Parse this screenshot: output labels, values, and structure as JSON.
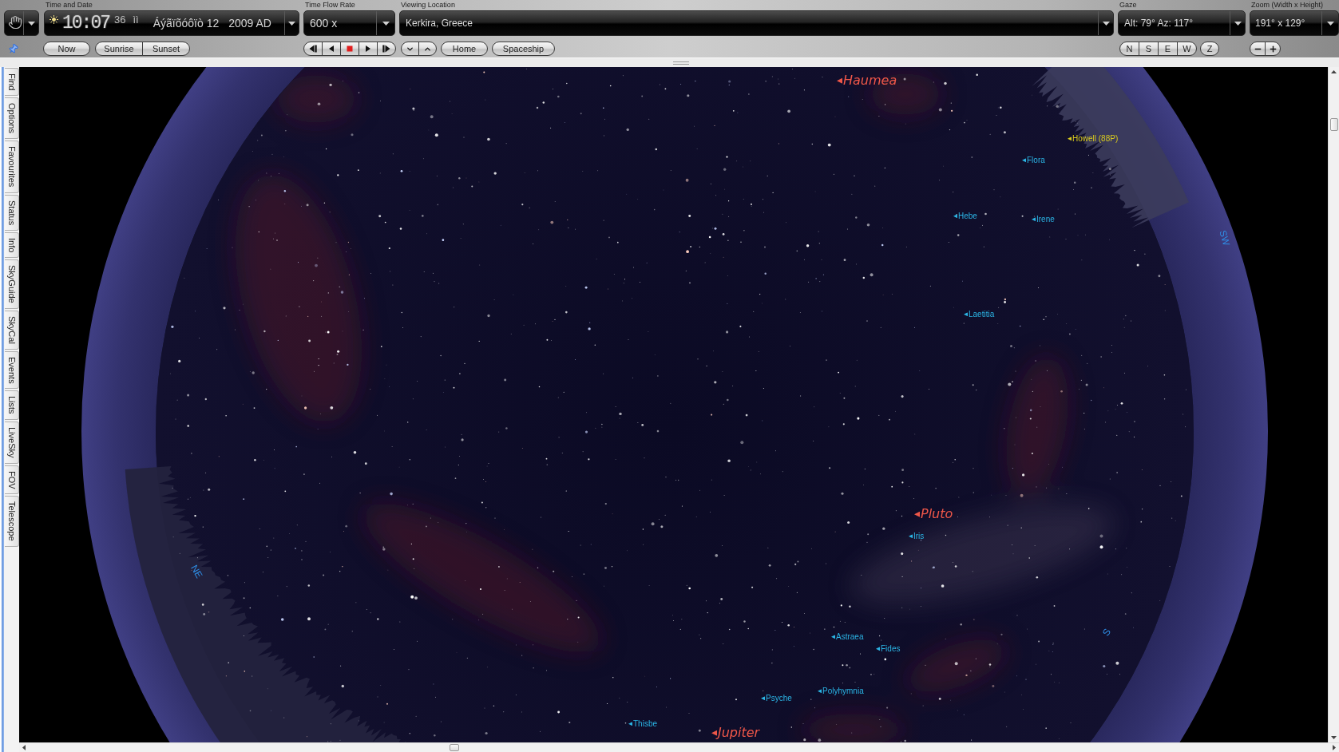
{
  "toolbar": {
    "time_date": {
      "label": "Time and Date",
      "time": "10:07",
      "seconds": "36",
      "period": "ìì",
      "date": "Áýãïõóôïò 12",
      "year": "2009 AD"
    },
    "time_flow_rate": {
      "label": "Time Flow Rate",
      "value": "600 x"
    },
    "viewing_location": {
      "label": "Viewing Location",
      "value": "Kerkira, Greece"
    },
    "gaze": {
      "label": "Gaze",
      "value": "Alt: 79° Az: 117°"
    },
    "zoom": {
      "label": "Zoom (Width x Height)",
      "value": "191° x 129°"
    },
    "now_button": "Now",
    "sun_buttons": [
      "Sunrise",
      "Sunset"
    ],
    "view_buttons": [
      "Home",
      "Spaceship"
    ],
    "direction_buttons": [
      "N",
      "S",
      "E",
      "W"
    ],
    "zenith_button": "Z"
  },
  "sidebar_tabs": [
    {
      "label": "Find",
      "selected": false
    },
    {
      "label": "Options",
      "selected": false
    },
    {
      "label": "Favourites",
      "selected": false
    },
    {
      "label": "Status",
      "selected": false
    },
    {
      "label": "Info",
      "selected": false
    },
    {
      "label": "SkyGuide",
      "selected": false
    },
    {
      "label": "SkyCal",
      "selected": false
    },
    {
      "label": "Events",
      "selected": false
    },
    {
      "label": "Lists",
      "selected": false
    },
    {
      "label": "LiveSky",
      "selected": false
    },
    {
      "label": "FOV",
      "selected": false
    },
    {
      "label": "Telescope",
      "selected": false
    }
  ],
  "sky_labels": [
    {
      "name": "Haumea",
      "kind": "planet"
    },
    {
      "name": "Howell (88P)",
      "kind": "comet"
    },
    {
      "name": "Flora",
      "kind": "asteroid"
    },
    {
      "name": "Hebe",
      "kind": "asteroid"
    },
    {
      "name": "Irene",
      "kind": "asteroid"
    },
    {
      "name": "Laetitia",
      "kind": "asteroid"
    },
    {
      "name": "Pluto",
      "kind": "planet"
    },
    {
      "name": "Iris",
      "kind": "asteroid"
    },
    {
      "name": "Astraea",
      "kind": "asteroid"
    },
    {
      "name": "Fides",
      "kind": "asteroid"
    },
    {
      "name": "Polyhymnia",
      "kind": "asteroid"
    },
    {
      "name": "Psyche",
      "kind": "asteroid"
    },
    {
      "name": "Thisbe",
      "kind": "asteroid"
    },
    {
      "name": "Jupiter",
      "kind": "planet"
    }
  ],
  "compass_labels": [
    "SW",
    "NE",
    "S"
  ]
}
